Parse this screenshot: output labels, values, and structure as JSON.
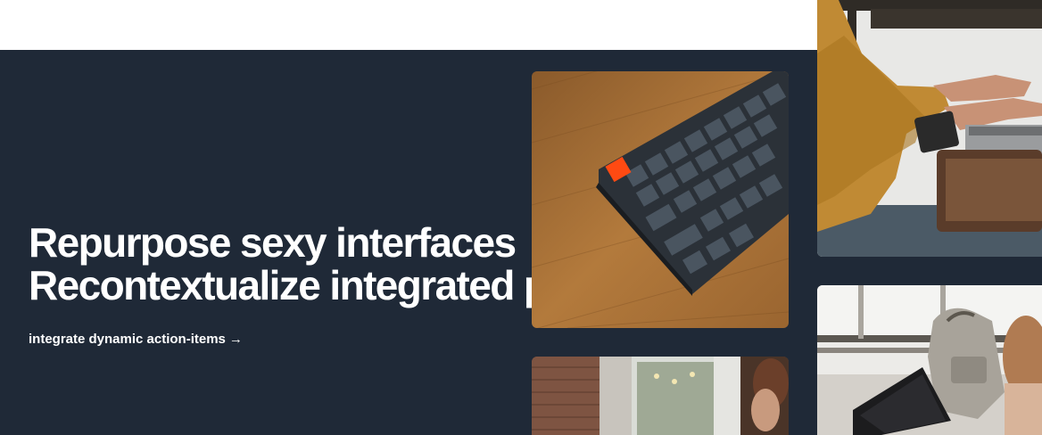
{
  "hero": {
    "headline_line1": "Repurpose sexy interfaces",
    "headline_line2": "Recontextualize integrated paradigms",
    "cta_label": "integrate dynamic action-items",
    "cta_arrow": "→"
  },
  "colors": {
    "hero_background": "#1f2937",
    "page_background": "#ffffff",
    "text": "#ffffff"
  },
  "photos": [
    {
      "subject": "mechanical keyboard with orange escape key on wooden desk"
    },
    {
      "subject": "cafe interior with brick wall and window"
    },
    {
      "subject": "person in mustard sweater typing on laptop"
    },
    {
      "subject": "backpack and laptop on cafe table by window"
    }
  ]
}
